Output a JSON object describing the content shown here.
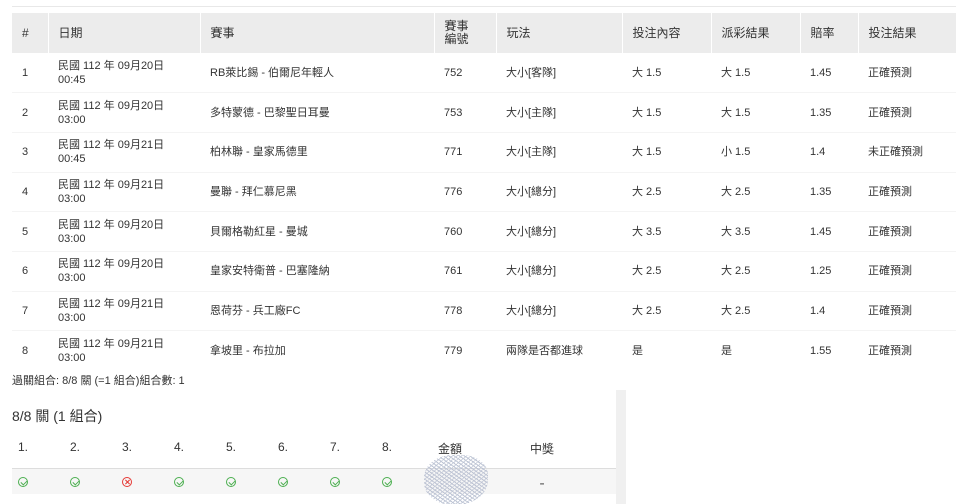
{
  "bets_table": {
    "headers": {
      "num": "#",
      "date": "日期",
      "event": "賽事",
      "event_id": "賽事編號",
      "play": "玩法",
      "bet": "投注內容",
      "result": "派彩結果",
      "odds": "賠率",
      "outcome": "投注結果"
    },
    "rows": [
      {
        "num": "1",
        "date1": "民國 112 年 09月20日",
        "date2": "00:45",
        "event": "RB萊比錫 - 伯爾尼年輕人",
        "event_id": "752",
        "play": "大小[客隊]",
        "bet": "大 1.5",
        "result": "大 1.5",
        "odds": "1.45",
        "outcome": "正確預測"
      },
      {
        "num": "2",
        "date1": "民國 112 年 09月20日",
        "date2": "03:00",
        "event": "多特蒙德 - 巴黎聖日耳曼",
        "event_id": "753",
        "play": "大小[主隊]",
        "bet": "大 1.5",
        "result": "大 1.5",
        "odds": "1.35",
        "outcome": "正確預測"
      },
      {
        "num": "3",
        "date1": "民國 112 年 09月21日",
        "date2": "00:45",
        "event": "柏林聯 - 皇家馬德里",
        "event_id": "771",
        "play": "大小[主隊]",
        "bet": "大 1.5",
        "result": "小 1.5",
        "odds": "1.4",
        "outcome": "未正確預測"
      },
      {
        "num": "4",
        "date1": "民國 112 年 09月21日",
        "date2": "03:00",
        "event": "曼聯 - 拜仁慕尼黑",
        "event_id": "776",
        "play": "大小[總分]",
        "bet": "大 2.5",
        "result": "大 2.5",
        "odds": "1.35",
        "outcome": "正確預測"
      },
      {
        "num": "5",
        "date1": "民國 112 年 09月20日",
        "date2": "03:00",
        "event": "貝爾格勒紅星 - 曼城",
        "event_id": "760",
        "play": "大小[總分]",
        "bet": "大 3.5",
        "result": "大 3.5",
        "odds": "1.45",
        "outcome": "正確預測"
      },
      {
        "num": "6",
        "date1": "民國 112 年 09月20日",
        "date2": "03:00",
        "event": "皇家安特衛普 - 巴塞隆納",
        "event_id": "761",
        "play": "大小[總分]",
        "bet": "大 2.5",
        "result": "大 2.5",
        "odds": "1.25",
        "outcome": "正確預測"
      },
      {
        "num": "7",
        "date1": "民國 112 年 09月21日",
        "date2": "03:00",
        "event": "恩荷芬 - 兵工廠FC",
        "event_id": "778",
        "play": "大小[總分]",
        "bet": "大 2.5",
        "result": "大 2.5",
        "odds": "1.4",
        "outcome": "正確預測"
      },
      {
        "num": "8",
        "date1": "民國 112 年 09月21日",
        "date2": "03:00",
        "event": "拿坡里 - 布拉加",
        "event_id": "779",
        "play": "兩隊是否都進球",
        "bet": "是",
        "result": "是",
        "odds": "1.55",
        "outcome": "正確預測"
      }
    ]
  },
  "summary": "過關組合: 8/8 關 (=1 組合)組合數: 1",
  "combo": {
    "title": "8/8 關 (1 組合)",
    "headers": [
      "1.",
      "2.",
      "3.",
      "4.",
      "5.",
      "6.",
      "7.",
      "8.",
      "金額",
      "中獎"
    ],
    "legs": [
      "ok-icon",
      "ok-icon",
      "bad-icon",
      "ok-icon",
      "ok-icon",
      "ok-icon",
      "ok-icon",
      "ok-icon"
    ],
    "prize": "-"
  },
  "colors": {
    "header_bg": "#ececec",
    "ok": "#4caf50",
    "bad": "#e53935"
  }
}
